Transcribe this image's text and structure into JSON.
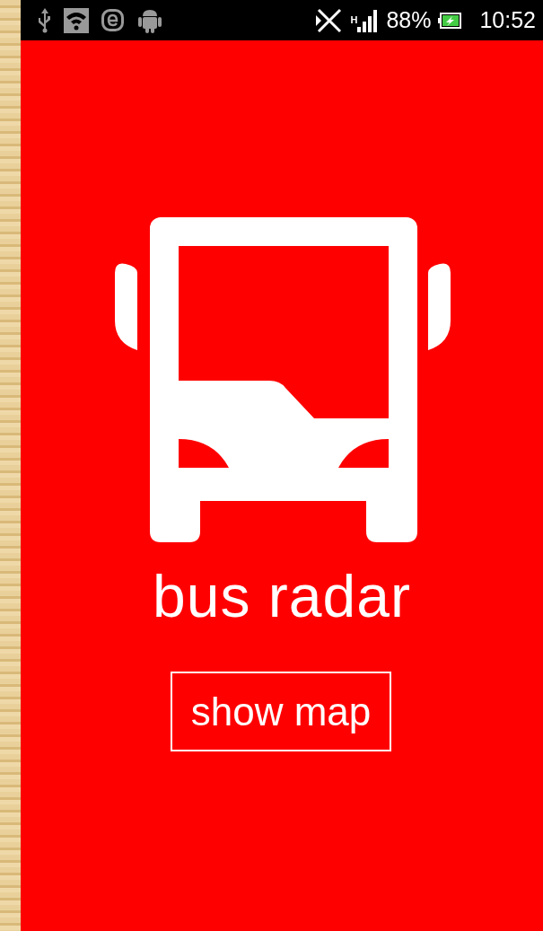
{
  "status_bar": {
    "network_type": "H",
    "battery": "88%",
    "time": "10:52"
  },
  "app": {
    "title": "bus radar",
    "button": "show map"
  }
}
